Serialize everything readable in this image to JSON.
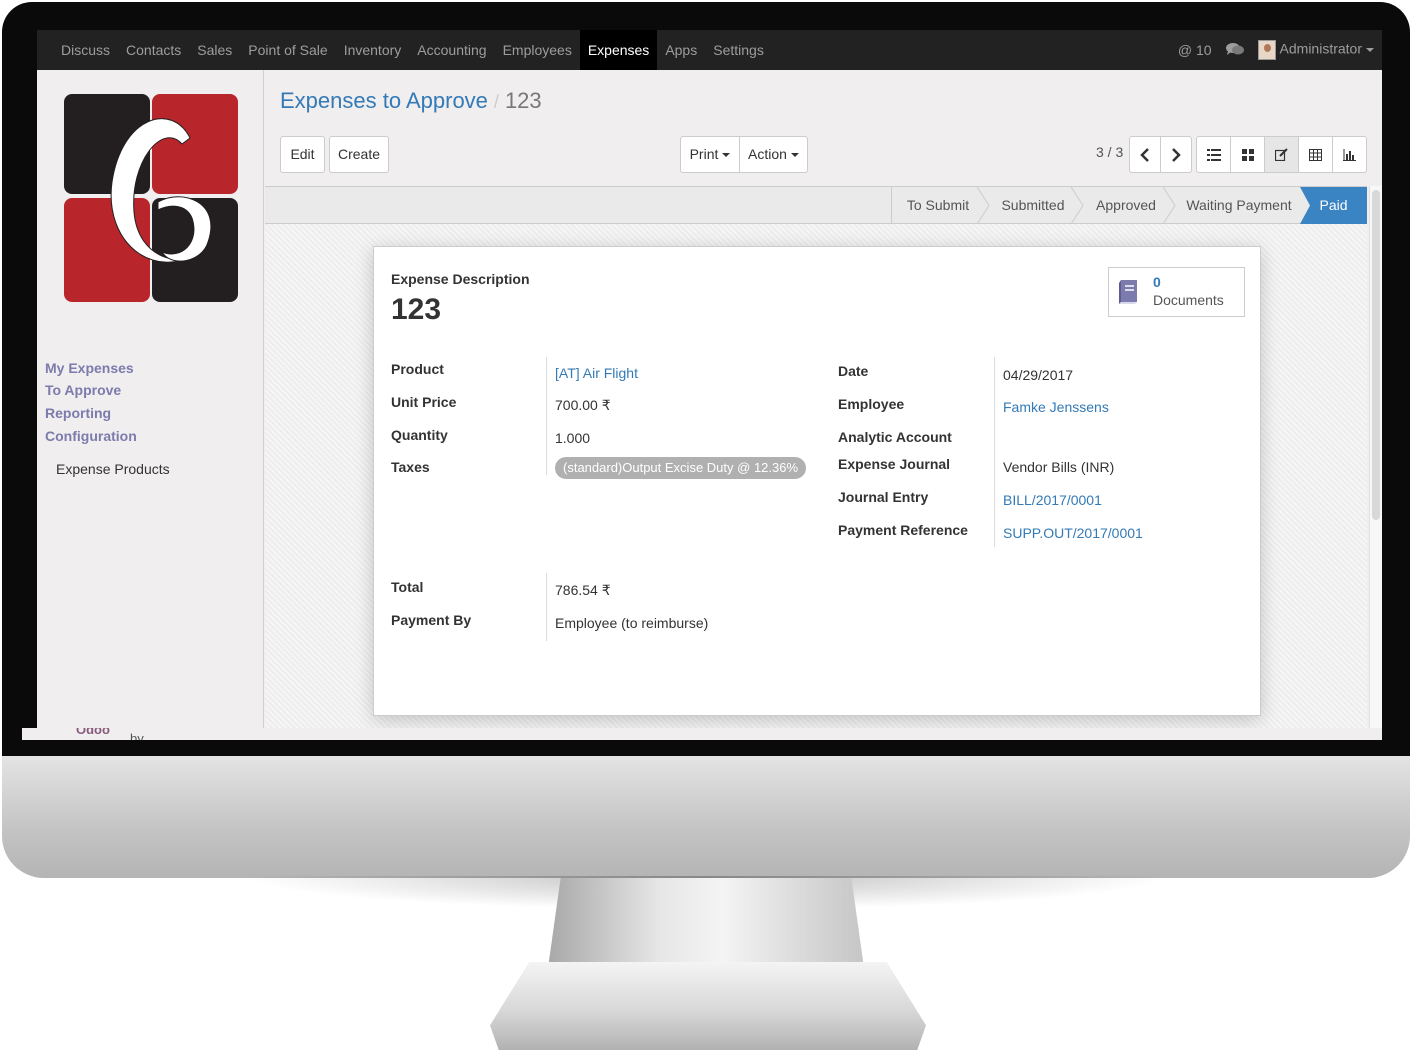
{
  "topnav": {
    "menu": [
      "Discuss",
      "Contacts",
      "Sales",
      "Point of Sale",
      "Inventory",
      "Accounting",
      "Employees",
      "Expenses",
      "Apps",
      "Settings"
    ],
    "active": "Expenses",
    "mentions": "@ 10",
    "user": "Administrator"
  },
  "sidebar": {
    "sections": [
      "My Expenses",
      "To Approve",
      "Reporting",
      "Configuration"
    ],
    "sub_items": [
      "Expense Products"
    ],
    "footer_text": "Powered by",
    "footer_brand": "Odoo"
  },
  "breadcrumb": {
    "parent": "Expenses to Approve",
    "separator": "/",
    "current": "123"
  },
  "toolbar": {
    "edit": "Edit",
    "create": "Create",
    "print": "Print",
    "action": "Action",
    "pager": "3 / 3"
  },
  "statusbar": {
    "stages": [
      "To Submit",
      "Submitted",
      "Approved",
      "Waiting Payment",
      "Paid"
    ],
    "current": "Paid"
  },
  "form": {
    "description_label": "Expense Description",
    "description": "123",
    "documents_count": "0",
    "documents_label": "Documents",
    "left": [
      {
        "label": "Product",
        "value": "[AT] Air Flight",
        "link": true
      },
      {
        "label": "Unit Price",
        "value": "700.00 ₹",
        "link": false
      },
      {
        "label": "Quantity",
        "value": "1.000",
        "link": false
      },
      {
        "label": "Taxes",
        "value": "(standard)Output Excise Duty @ 12.36%",
        "link": false
      }
    ],
    "right": [
      {
        "label": "Date",
        "value": "04/29/2017",
        "link": false
      },
      {
        "label": "Employee",
        "value": "Famke Jenssens",
        "link": true
      },
      {
        "label": "Analytic Account",
        "value": "",
        "link": false
      },
      {
        "label": "Expense Journal",
        "value": "Vendor Bills (INR)",
        "link": false
      },
      {
        "label": "Journal Entry",
        "value": "BILL/2017/0001",
        "link": true
      },
      {
        "label": "Payment Reference",
        "value": "SUPP.OUT/2017/0001",
        "link": true
      }
    ],
    "bottom": [
      {
        "label": "Total",
        "value": "786.54 ₹"
      },
      {
        "label": "Payment By",
        "value": "Employee (to reimburse)"
      }
    ]
  },
  "colors": {
    "navbar": "#222222",
    "link": "#337ab7",
    "sidebar_section": "#7c7bad",
    "stage_active": "#3b84c4",
    "logo_red": "#b8262b",
    "logo_black": "#231f20"
  }
}
